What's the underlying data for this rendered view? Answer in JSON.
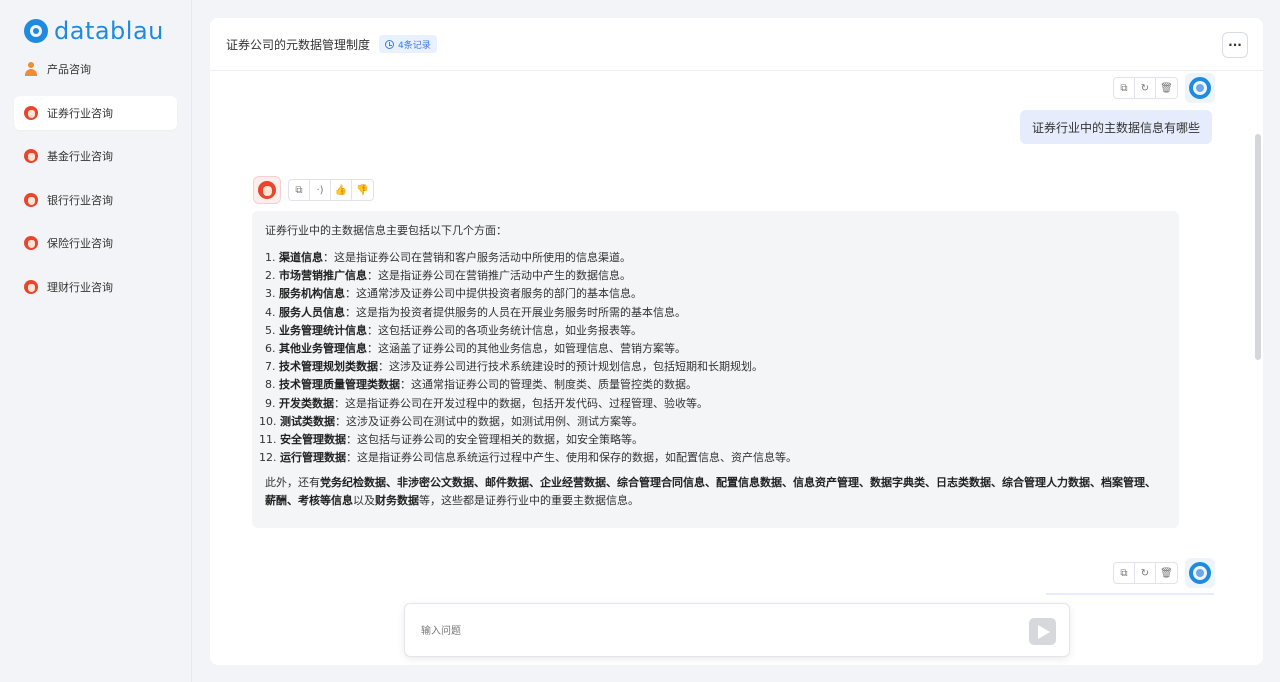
{
  "brand": {
    "name": "datablau"
  },
  "sidebar": {
    "items": [
      {
        "label": "产品咨询",
        "icon": "person-icon",
        "active": false
      },
      {
        "label": "证券行业咨询",
        "icon": "assistant-icon",
        "active": true
      },
      {
        "label": "基金行业咨询",
        "icon": "assistant-icon",
        "active": false
      },
      {
        "label": "银行行业咨询",
        "icon": "assistant-icon",
        "active": false
      },
      {
        "label": "保险行业咨询",
        "icon": "assistant-icon",
        "active": false
      },
      {
        "label": "理财行业咨询",
        "icon": "assistant-icon",
        "active": false
      }
    ]
  },
  "header": {
    "title": "证券公司的元数据管理制度",
    "record_badge": "4条记录",
    "more_label": "···"
  },
  "conversation": {
    "user_message": "证券行业中的主数据信息有哪些",
    "answer": {
      "intro": "证券行业中的主数据信息主要包括以下几个方面：",
      "items": [
        {
          "num": "1.",
          "term": "渠道信息",
          "desc": "：这是指证券公司在营销和客户服务活动中所使用的信息渠道。"
        },
        {
          "num": "2.",
          "term": "市场营销推广信息",
          "desc": "：这是指证券公司在营销推广活动中产生的数据信息。"
        },
        {
          "num": "3.",
          "term": "服务机构信息",
          "desc": "：这通常涉及证券公司中提供投资者服务的部门的基本信息。"
        },
        {
          "num": "4.",
          "term": "服务人员信息",
          "desc": "：这是指为投资者提供服务的人员在开展业务服务时所需的基本信息。"
        },
        {
          "num": "5.",
          "term": "业务管理统计信息",
          "desc": "：这包括证券公司的各项业务统计信息，如业务报表等。"
        },
        {
          "num": "6.",
          "term": "其他业务管理信息",
          "desc": "：这涵盖了证券公司的其他业务信息，如管理信息、营销方案等。"
        },
        {
          "num": "7.",
          "term": "技术管理规划类数据",
          "desc": "：这涉及证券公司进行技术系统建设时的预计规划信息，包括短期和长期规划。"
        },
        {
          "num": "8.",
          "term": "技术管理质量管理类数据",
          "desc": "：这通常指证券公司的管理类、制度类、质量管控类的数据。"
        },
        {
          "num": "9.",
          "term": "开发类数据",
          "desc": "：这是指证券公司在开发过程中的数据，包括开发代码、过程管理、验收等。"
        },
        {
          "num": "10.",
          "term": "测试类数据",
          "desc": "：这涉及证券公司在测试中的数据，如测试用例、测试方案等。"
        },
        {
          "num": "11.",
          "term": "安全管理数据",
          "desc": "：这包括与证券公司的安全管理相关的数据，如安全策略等。"
        },
        {
          "num": "12.",
          "term": "运行管理数据",
          "desc": "：这是指证券公司信息系统运行过程中产生、使用和保存的数据，如配置信息、资产信息等。"
        }
      ],
      "tail_prefix": "此外，还有",
      "tail_terms_1": "党务纪检数据、非涉密公文数据、邮件数据、企业经营数据、综合管理合同信息、配置信息数据、信息资产管理、数据字典类、日志类数据、综合管理人力数据、档案管理、薪酬、考核等信息",
      "tail_mid": "以及",
      "tail_terms_2": "财务数据",
      "tail_suffix": "等，这些都是证券行业中的重要主数据信息。"
    }
  },
  "input": {
    "placeholder": "输入问题",
    "value": ""
  },
  "colors": {
    "accent": "#1f8be0",
    "badge_bg": "#e8f1fd",
    "user_bubble": "#e6ecfb",
    "answer_bg": "#f4f5f7"
  }
}
